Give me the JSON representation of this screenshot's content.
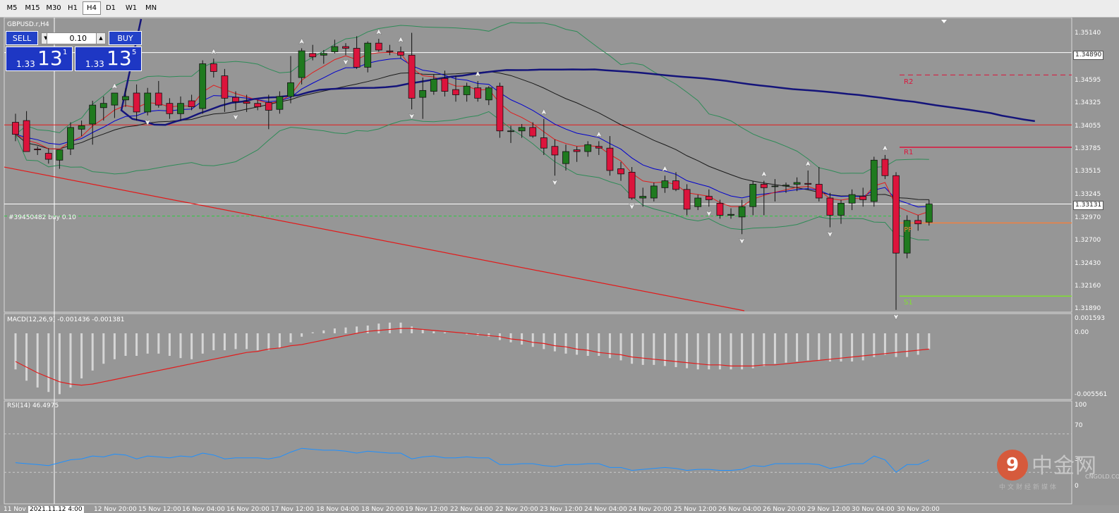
{
  "toolbar": {
    "timeframes": [
      "M5",
      "M15",
      "M30",
      "H1",
      "H4",
      "D1",
      "W1",
      "MN"
    ],
    "active": "H4"
  },
  "chart": {
    "symbol_label": "GBPUSD.r,H4",
    "order_label": "#39450482 buy 0.10",
    "price_axis": [
      "1.35140",
      "1.34890",
      "1.34595",
      "1.34325",
      "1.34055",
      "1.33785",
      "1.33515",
      "1.33245",
      "1.33131",
      "1.32970",
      "1.32700",
      "1.32430",
      "1.32160",
      "1.31890"
    ],
    "current_price": "1.33131",
    "highlight_price": "1.34890",
    "time_axis": [
      "11 Nov",
      "2021.11.12 4:00",
      "12 Nov 20:00",
      "15 Nov 12:00",
      "16 Nov 04:00",
      "16 Nov 20:00",
      "17 Nov 12:00",
      "18 Nov 04:00",
      "18 Nov 20:00",
      "19 Nov 12:00",
      "22 Nov 04:00",
      "22 Nov 20:00",
      "23 Nov 12:00",
      "24 Nov 04:00",
      "24 Nov 20:00",
      "25 Nov 12:00",
      "26 Nov 04:00",
      "26 Nov 20:00",
      "29 Nov 12:00",
      "30 Nov 04:00",
      "30 Nov 20:00"
    ],
    "levels": {
      "r2": "R2",
      "r1": "R1",
      "pp": "PP",
      "s1": "S1"
    },
    "colors": {
      "bull": "#1f7a1f",
      "bear": "#dc143c",
      "ma_blue": "#0000cd",
      "ma_navy": "#14147a",
      "ma_red": "#e11d1d",
      "ma_black": "#1a1a1a",
      "bands": "#2e8b57",
      "trend": "#e31a1a"
    }
  },
  "one_click": {
    "sell_label": "SELL",
    "buy_label": "BUY",
    "lot": "0.10",
    "sell_small": "1.33",
    "sell_big": "13",
    "sell_sup": "1",
    "buy_small": "1.33",
    "buy_big": "13",
    "buy_sup": "5"
  },
  "macd": {
    "label": "MACD(12,26,9) -0.001436 -0.001381",
    "axis": [
      "0.001593",
      "0.00",
      "-0.005561"
    ]
  },
  "rsi": {
    "label": "RSI(14) 46.4975",
    "axis": [
      "100",
      "70",
      "30",
      "0"
    ]
  },
  "watermark": {
    "logo_char": "9",
    "brand": "中金网",
    "domain": "CNGOLD.COM.CN",
    "tagline": "中文财经新媒体"
  },
  "chart_data": {
    "type": "candlestick",
    "title": "GBPUSD.r,H4",
    "ylim": [
      1.3189,
      1.3528
    ],
    "candles": [
      {
        "o": 1.3408,
        "h": 1.3418,
        "l": 1.3386,
        "c": 1.3394
      },
      {
        "o": 1.341,
        "h": 1.3421,
        "l": 1.3384,
        "c": 1.3374
      },
      {
        "o": 1.3377,
        "h": 1.338,
        "l": 1.337,
        "c": 1.3376
      },
      {
        "o": 1.3372,
        "h": 1.3378,
        "l": 1.336,
        "c": 1.3365
      },
      {
        "o": 1.3364,
        "h": 1.3376,
        "l": 1.3354,
        "c": 1.3376
      },
      {
        "o": 1.3377,
        "h": 1.3408,
        "l": 1.337,
        "c": 1.3402
      },
      {
        "o": 1.34,
        "h": 1.341,
        "l": 1.3392,
        "c": 1.3404
      },
      {
        "o": 1.3406,
        "h": 1.3433,
        "l": 1.3382,
        "c": 1.3428
      },
      {
        "o": 1.3425,
        "h": 1.3438,
        "l": 1.341,
        "c": 1.343
      },
      {
        "o": 1.3428,
        "h": 1.3442,
        "l": 1.3413,
        "c": 1.3442
      },
      {
        "o": 1.3434,
        "h": 1.3448,
        "l": 1.3426,
        "c": 1.3438
      },
      {
        "o": 1.3442,
        "h": 1.3452,
        "l": 1.341,
        "c": 1.342
      },
      {
        "o": 1.342,
        "h": 1.3448,
        "l": 1.3416,
        "c": 1.3442
      },
      {
        "o": 1.3442,
        "h": 1.3456,
        "l": 1.3425,
        "c": 1.3428
      },
      {
        "o": 1.343,
        "h": 1.3436,
        "l": 1.3412,
        "c": 1.3418
      },
      {
        "o": 1.3418,
        "h": 1.3438,
        "l": 1.341,
        "c": 1.343
      },
      {
        "o": 1.3433,
        "h": 1.344,
        "l": 1.3422,
        "c": 1.3426
      },
      {
        "o": 1.3424,
        "h": 1.348,
        "l": 1.3418,
        "c": 1.3476
      },
      {
        "o": 1.3476,
        "h": 1.3482,
        "l": 1.346,
        "c": 1.3467
      },
      {
        "o": 1.3462,
        "h": 1.347,
        "l": 1.342,
        "c": 1.3436
      },
      {
        "o": 1.3437,
        "h": 1.3444,
        "l": 1.3422,
        "c": 1.3432
      },
      {
        "o": 1.3432,
        "h": 1.344,
        "l": 1.342,
        "c": 1.343
      },
      {
        "o": 1.343,
        "h": 1.3434,
        "l": 1.3422,
        "c": 1.3426
      },
      {
        "o": 1.3431,
        "h": 1.344,
        "l": 1.34,
        "c": 1.3422
      },
      {
        "o": 1.3423,
        "h": 1.3444,
        "l": 1.3418,
        "c": 1.3438
      },
      {
        "o": 1.3438,
        "h": 1.3485,
        "l": 1.343,
        "c": 1.3454
      },
      {
        "o": 1.346,
        "h": 1.3494,
        "l": 1.3452,
        "c": 1.3491
      },
      {
        "o": 1.3488,
        "h": 1.3498,
        "l": 1.348,
        "c": 1.3484
      },
      {
        "o": 1.3486,
        "h": 1.3492,
        "l": 1.3476,
        "c": 1.3488
      },
      {
        "o": 1.349,
        "h": 1.3504,
        "l": 1.3488,
        "c": 1.3496
      },
      {
        "o": 1.3496,
        "h": 1.35,
        "l": 1.3486,
        "c": 1.3494
      },
      {
        "o": 1.3494,
        "h": 1.3508,
        "l": 1.347,
        "c": 1.3472
      },
      {
        "o": 1.3472,
        "h": 1.3502,
        "l": 1.3466,
        "c": 1.35
      },
      {
        "o": 1.35,
        "h": 1.3505,
        "l": 1.349,
        "c": 1.3492
      },
      {
        "o": 1.3491,
        "h": 1.3498,
        "l": 1.3486,
        "c": 1.349
      },
      {
        "o": 1.349,
        "h": 1.3496,
        "l": 1.3482,
        "c": 1.3486
      },
      {
        "o": 1.3486,
        "h": 1.3512,
        "l": 1.3423,
        "c": 1.3436
      },
      {
        "o": 1.3437,
        "h": 1.346,
        "l": 1.3412,
        "c": 1.3445
      },
      {
        "o": 1.3444,
        "h": 1.3464,
        "l": 1.344,
        "c": 1.3458
      },
      {
        "o": 1.3459,
        "h": 1.3468,
        "l": 1.3438,
        "c": 1.3444
      },
      {
        "o": 1.3446,
        "h": 1.3462,
        "l": 1.3432,
        "c": 1.344
      },
      {
        "o": 1.344,
        "h": 1.3454,
        "l": 1.3432,
        "c": 1.345
      },
      {
        "o": 1.3448,
        "h": 1.3456,
        "l": 1.3432,
        "c": 1.3436
      },
      {
        "o": 1.3434,
        "h": 1.345,
        "l": 1.3428,
        "c": 1.3448
      },
      {
        "o": 1.345,
        "h": 1.3454,
        "l": 1.339,
        "c": 1.3398
      },
      {
        "o": 1.3398,
        "h": 1.3404,
        "l": 1.3384,
        "c": 1.3398
      },
      {
        "o": 1.3398,
        "h": 1.3406,
        "l": 1.339,
        "c": 1.3402
      },
      {
        "o": 1.3402,
        "h": 1.3408,
        "l": 1.339,
        "c": 1.3392
      },
      {
        "o": 1.339,
        "h": 1.3412,
        "l": 1.337,
        "c": 1.3378
      },
      {
        "o": 1.338,
        "h": 1.3388,
        "l": 1.3346,
        "c": 1.337
      },
      {
        "o": 1.336,
        "h": 1.3382,
        "l": 1.3352,
        "c": 1.3374
      },
      {
        "o": 1.3376,
        "h": 1.338,
        "l": 1.3362,
        "c": 1.3374
      },
      {
        "o": 1.3374,
        "h": 1.3386,
        "l": 1.3368,
        "c": 1.3382
      },
      {
        "o": 1.338,
        "h": 1.3386,
        "l": 1.337,
        "c": 1.3378
      },
      {
        "o": 1.3378,
        "h": 1.3392,
        "l": 1.3346,
        "c": 1.3352
      },
      {
        "o": 1.3354,
        "h": 1.3362,
        "l": 1.334,
        "c": 1.3348
      },
      {
        "o": 1.335,
        "h": 1.3356,
        "l": 1.3318,
        "c": 1.332
      },
      {
        "o": 1.332,
        "h": 1.3332,
        "l": 1.331,
        "c": 1.3322
      },
      {
        "o": 1.332,
        "h": 1.3338,
        "l": 1.3316,
        "c": 1.3334
      },
      {
        "o": 1.3332,
        "h": 1.3346,
        "l": 1.3326,
        "c": 1.334
      },
      {
        "o": 1.334,
        "h": 1.335,
        "l": 1.3328,
        "c": 1.333
      },
      {
        "o": 1.333,
        "h": 1.3336,
        "l": 1.33,
        "c": 1.3307
      },
      {
        "o": 1.331,
        "h": 1.3324,
        "l": 1.3306,
        "c": 1.332
      },
      {
        "o": 1.3322,
        "h": 1.333,
        "l": 1.331,
        "c": 1.3318
      },
      {
        "o": 1.3314,
        "h": 1.3318,
        "l": 1.3296,
        "c": 1.33
      },
      {
        "o": 1.33,
        "h": 1.3308,
        "l": 1.3296,
        "c": 1.3301
      },
      {
        "o": 1.3298,
        "h": 1.3318,
        "l": 1.3278,
        "c": 1.331
      },
      {
        "o": 1.331,
        "h": 1.334,
        "l": 1.33,
        "c": 1.3336
      },
      {
        "o": 1.3336,
        "h": 1.334,
        "l": 1.33,
        "c": 1.3332
      },
      {
        "o": 1.3334,
        "h": 1.3342,
        "l": 1.3316,
        "c": 1.3334
      },
      {
        "o": 1.3334,
        "h": 1.3338,
        "l": 1.3326,
        "c": 1.3335
      },
      {
        "o": 1.3336,
        "h": 1.3344,
        "l": 1.3328,
        "c": 1.3338
      },
      {
        "o": 1.3337,
        "h": 1.3352,
        "l": 1.333,
        "c": 1.3336
      },
      {
        "o": 1.3336,
        "h": 1.3356,
        "l": 1.3316,
        "c": 1.332
      },
      {
        "o": 1.332,
        "h": 1.3326,
        "l": 1.3286,
        "c": 1.33
      },
      {
        "o": 1.33,
        "h": 1.3318,
        "l": 1.329,
        "c": 1.3314
      },
      {
        "o": 1.3314,
        "h": 1.333,
        "l": 1.3306,
        "c": 1.3324
      },
      {
        "o": 1.3322,
        "h": 1.3332,
        "l": 1.331,
        "c": 1.3318
      },
      {
        "o": 1.3316,
        "h": 1.3368,
        "l": 1.331,
        "c": 1.3364
      },
      {
        "o": 1.3365,
        "h": 1.337,
        "l": 1.3342,
        "c": 1.3346
      },
      {
        "o": 1.3346,
        "h": 1.335,
        "l": 1.319,
        "c": 1.3256
      },
      {
        "o": 1.3256,
        "h": 1.33,
        "l": 1.325,
        "c": 1.3294
      },
      {
        "o": 1.3294,
        "h": 1.33,
        "l": 1.3282,
        "c": 1.329
      },
      {
        "o": 1.3292,
        "h": 1.3318,
        "l": 1.3288,
        "c": 1.3313
      }
    ],
    "macd_hist": [
      -0.0032,
      -0.0042,
      -0.0048,
      -0.0052,
      -0.0054,
      -0.0048,
      -0.004,
      -0.0033,
      -0.0027,
      -0.0023,
      -0.002,
      -0.002,
      -0.0018,
      -0.0018,
      -0.002,
      -0.0022,
      -0.0023,
      -0.0018,
      -0.0015,
      -0.0015,
      -0.0014,
      -0.0014,
      -0.0015,
      -0.0015,
      -0.0013,
      -0.0008,
      -0.0003,
      0.0001,
      0.0003,
      0.0005,
      0.0006,
      0.0007,
      0.0008,
      0.001,
      0.0011,
      0.0011,
      0.0007,
      0.0004,
      0.0002,
      0.0001,
      0.0,
      -0.0001,
      -0.0002,
      -0.0003,
      -0.0006,
      -0.0008,
      -0.001,
      -0.0012,
      -0.0014,
      -0.0016,
      -0.0018,
      -0.0019,
      -0.002,
      -0.002,
      -0.0022,
      -0.0024,
      -0.0027,
      -0.0028,
      -0.0028,
      -0.0029,
      -0.003,
      -0.0031,
      -0.0032,
      -0.0032,
      -0.0032,
      -0.0032,
      -0.0032,
      -0.0031,
      -0.0029,
      -0.0027,
      -0.0026,
      -0.0025,
      -0.0024,
      -0.0024,
      -0.0025,
      -0.0025,
      -0.0025,
      -0.0024,
      -0.0021,
      -0.0019,
      -0.0021,
      -0.0021,
      -0.0019,
      -0.0014
    ],
    "macd_signal": [
      -0.0025,
      -0.003,
      -0.0035,
      -0.0039,
      -0.0043,
      -0.0045,
      -0.0046,
      -0.0045,
      -0.0043,
      -0.0041,
      -0.0039,
      -0.0037,
      -0.0035,
      -0.0033,
      -0.0031,
      -0.0029,
      -0.0027,
      -0.0025,
      -0.0023,
      -0.0021,
      -0.0019,
      -0.0017,
      -0.0016,
      -0.0014,
      -0.0013,
      -0.0011,
      -0.001,
      -0.0008,
      -0.0006,
      -0.0004,
      -0.0002,
      0.0,
      0.0002,
      0.0003,
      0.0004,
      0.0005,
      0.0005,
      0.0004,
      0.0003,
      0.0002,
      0.0001,
      0.0,
      -0.0001,
      -0.0002,
      -0.0003,
      -0.0005,
      -0.0006,
      -0.0008,
      -0.0009,
      -0.0011,
      -0.0012,
      -0.0014,
      -0.0015,
      -0.0017,
      -0.0018,
      -0.0019,
      -0.0021,
      -0.0022,
      -0.0023,
      -0.0024,
      -0.0025,
      -0.0026,
      -0.0027,
      -0.0028,
      -0.0028,
      -0.0029,
      -0.0029,
      -0.0029,
      -0.0028,
      -0.0028,
      -0.0027,
      -0.0026,
      -0.0025,
      -0.0024,
      -0.0023,
      -0.0022,
      -0.0021,
      -0.002,
      -0.0019,
      -0.0018,
      -0.0017,
      -0.0016,
      -0.0015,
      -0.0014
    ],
    "rsi": [
      40,
      39,
      38,
      37,
      40,
      43,
      44,
      47,
      46,
      49,
      48,
      44,
      47,
      46,
      45,
      47,
      46,
      50,
      48,
      44,
      45,
      45,
      45,
      44,
      46,
      51,
      55,
      54,
      53,
      53,
      52,
      50,
      52,
      51,
      50,
      50,
      44,
      46,
      47,
      45,
      45,
      46,
      45,
      45,
      38,
      38,
      39,
      39,
      37,
      36,
      38,
      38,
      39,
      39,
      35,
      35,
      32,
      33,
      34,
      35,
      34,
      32,
      33,
      33,
      32,
      32,
      33,
      37,
      36,
      39,
      39,
      39,
      39,
      38,
      34,
      36,
      39,
      39,
      47,
      43,
      30,
      38,
      38,
      43
    ]
  }
}
